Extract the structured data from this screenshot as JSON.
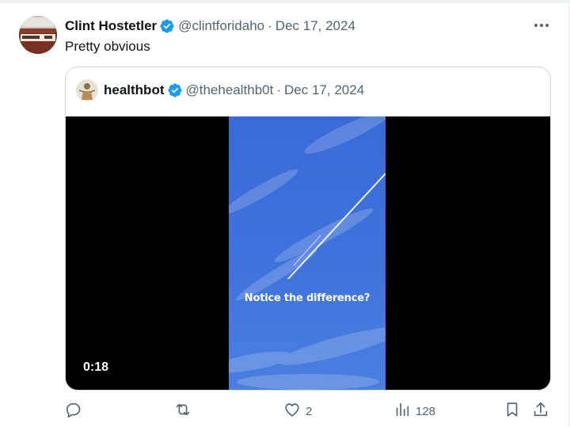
{
  "tweet": {
    "author_name": "Clint Hostetler",
    "handle": "@clintforidaho",
    "separator": "·",
    "date": "Dec 17, 2024",
    "text": "Pretty obvious"
  },
  "quote": {
    "author_name": "healthbot",
    "handle": "@thehealthb0t",
    "separator": "·",
    "date": "Dec 17, 2024",
    "video": {
      "caption": "Notice the difference?",
      "duration": "0:18"
    }
  },
  "actions": {
    "reply_count": "",
    "retweet_count": "",
    "like_count": "2",
    "views_count": "128"
  },
  "icons": {
    "verified": "verified-badge-icon",
    "more": "more-icon",
    "reply": "reply-icon",
    "retweet": "retweet-icon",
    "like": "heart-icon",
    "views": "views-icon",
    "bookmark": "bookmark-icon",
    "share": "share-icon"
  },
  "colors": {
    "verified": "#1d9bf0",
    "text_primary": "#0f1419",
    "text_secondary": "#536471",
    "border": "#cfd9de",
    "sky": "#3f6fd6"
  }
}
